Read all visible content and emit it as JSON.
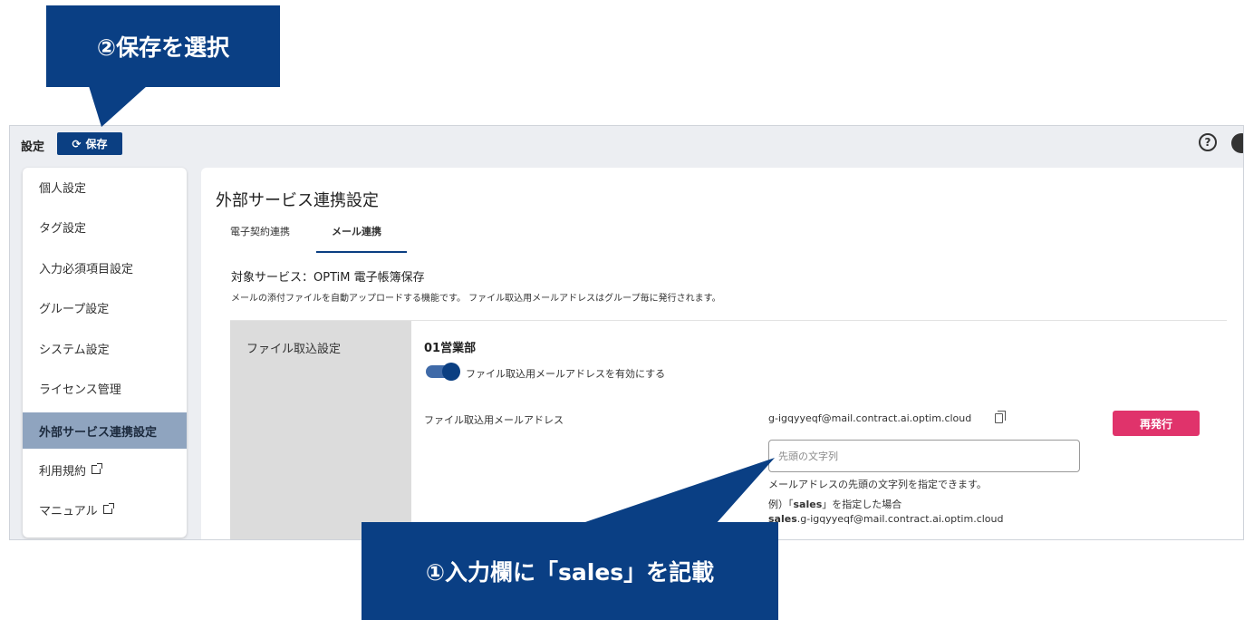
{
  "topbar": {
    "title": "設定",
    "save_label": "保存",
    "help_glyph": "?"
  },
  "sidebar": {
    "items": [
      {
        "label": "個人設定"
      },
      {
        "label": "タグ設定"
      },
      {
        "label": "入力必須項目設定"
      },
      {
        "label": "グループ設定"
      },
      {
        "label": "システム設定"
      },
      {
        "label": "ライセンス管理"
      },
      {
        "label": "外部サービス連携設定",
        "active": true
      },
      {
        "label": "利用規約",
        "external": true
      },
      {
        "label": "マニュアル",
        "external": true
      }
    ]
  },
  "main": {
    "title": "外部サービス連携設定",
    "tabs": [
      {
        "label": "電子契約連携"
      },
      {
        "label": "メール連携",
        "active": true
      }
    ],
    "service": "対象サービス：OPTiM 電子帳簿保存",
    "description": "メールの添付ファイルを自動アップロードする機能です。 ファイル取込用メールアドレスはグループ毎に発行されます。",
    "section_label": "ファイル取込設定",
    "group_name": "01営業部",
    "toggle_label": "ファイル取込用メールアドレスを有効にする",
    "toggle_on": true,
    "address_label": "ファイル取込用メールアドレス",
    "address": "g-igqyyeqf@mail.contract.ai.optim.cloud",
    "reissue_label": "再発行",
    "prefix_placeholder": "先頭の文字列",
    "prefix_value": "",
    "hint": "メールアドレスの先頭の文字列を指定できます。",
    "example_prefix": "例）「",
    "example_bold": "sales",
    "example_suffix": "」を指定した場合",
    "example_addr_bold": "sales",
    "example_addr_rest": ".g-igqyyeqf@mail.contract.ai.optim.cloud"
  },
  "callouts": {
    "save": "②保存を選択",
    "input": "①入力欄に「sales」を記載"
  },
  "colors": {
    "accent": "#0b3f82",
    "callout": "#0a3f84",
    "reissue": "#e0336b",
    "active_nav": "#8fa4bf"
  },
  "icons": {
    "save": "refresh-icon",
    "help": "help-circle-icon",
    "user": "user-account-icon",
    "copy": "copy-icon",
    "external": "external-link-icon"
  }
}
